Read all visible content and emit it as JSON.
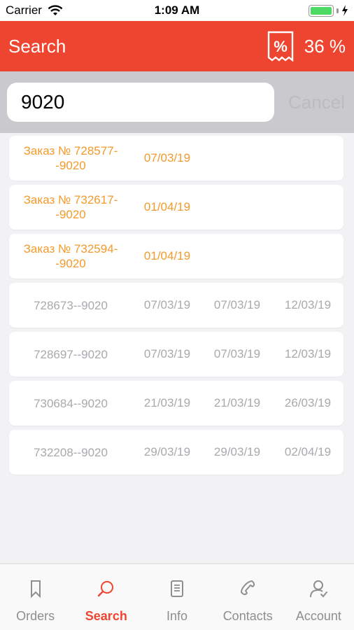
{
  "status_bar": {
    "carrier": "Carrier",
    "time": "1:09 AM"
  },
  "nav": {
    "title": "Search",
    "discount_value": "36 %",
    "discount_icon_text": "%",
    "accent_color": "#ee4530"
  },
  "search": {
    "query": "9020",
    "cancel_label": "Cancel"
  },
  "orders": [
    {
      "number": "Заказ № 728577--9020",
      "d1": "07/03/19",
      "d2": "",
      "d3": "",
      "state": "pending"
    },
    {
      "number": "Заказ № 732617--9020",
      "d1": "01/04/19",
      "d2": "",
      "d3": "",
      "state": "pending"
    },
    {
      "number": "Заказ № 732594--9020",
      "d1": "01/04/19",
      "d2": "",
      "d3": "",
      "state": "pending"
    },
    {
      "number": "728673--9020",
      "d1": "07/03/19",
      "d2": "07/03/19",
      "d3": "12/03/19",
      "state": "done"
    },
    {
      "number": "728697--9020",
      "d1": "07/03/19",
      "d2": "07/03/19",
      "d3": "12/03/19",
      "state": "done"
    },
    {
      "number": "730684--9020",
      "d1": "21/03/19",
      "d2": "21/03/19",
      "d3": "26/03/19",
      "state": "done"
    },
    {
      "number": "732208--9020",
      "d1": "29/03/19",
      "d2": "29/03/19",
      "d3": "02/04/19",
      "state": "done"
    }
  ],
  "tabs": [
    {
      "label": "Orders",
      "icon": "bookmark-icon",
      "active": false
    },
    {
      "label": "Search",
      "icon": "search-icon",
      "active": true
    },
    {
      "label": "Info",
      "icon": "document-icon",
      "active": false
    },
    {
      "label": "Contacts",
      "icon": "phone-icon",
      "active": false
    },
    {
      "label": "Account",
      "icon": "user-icon",
      "active": false
    }
  ]
}
